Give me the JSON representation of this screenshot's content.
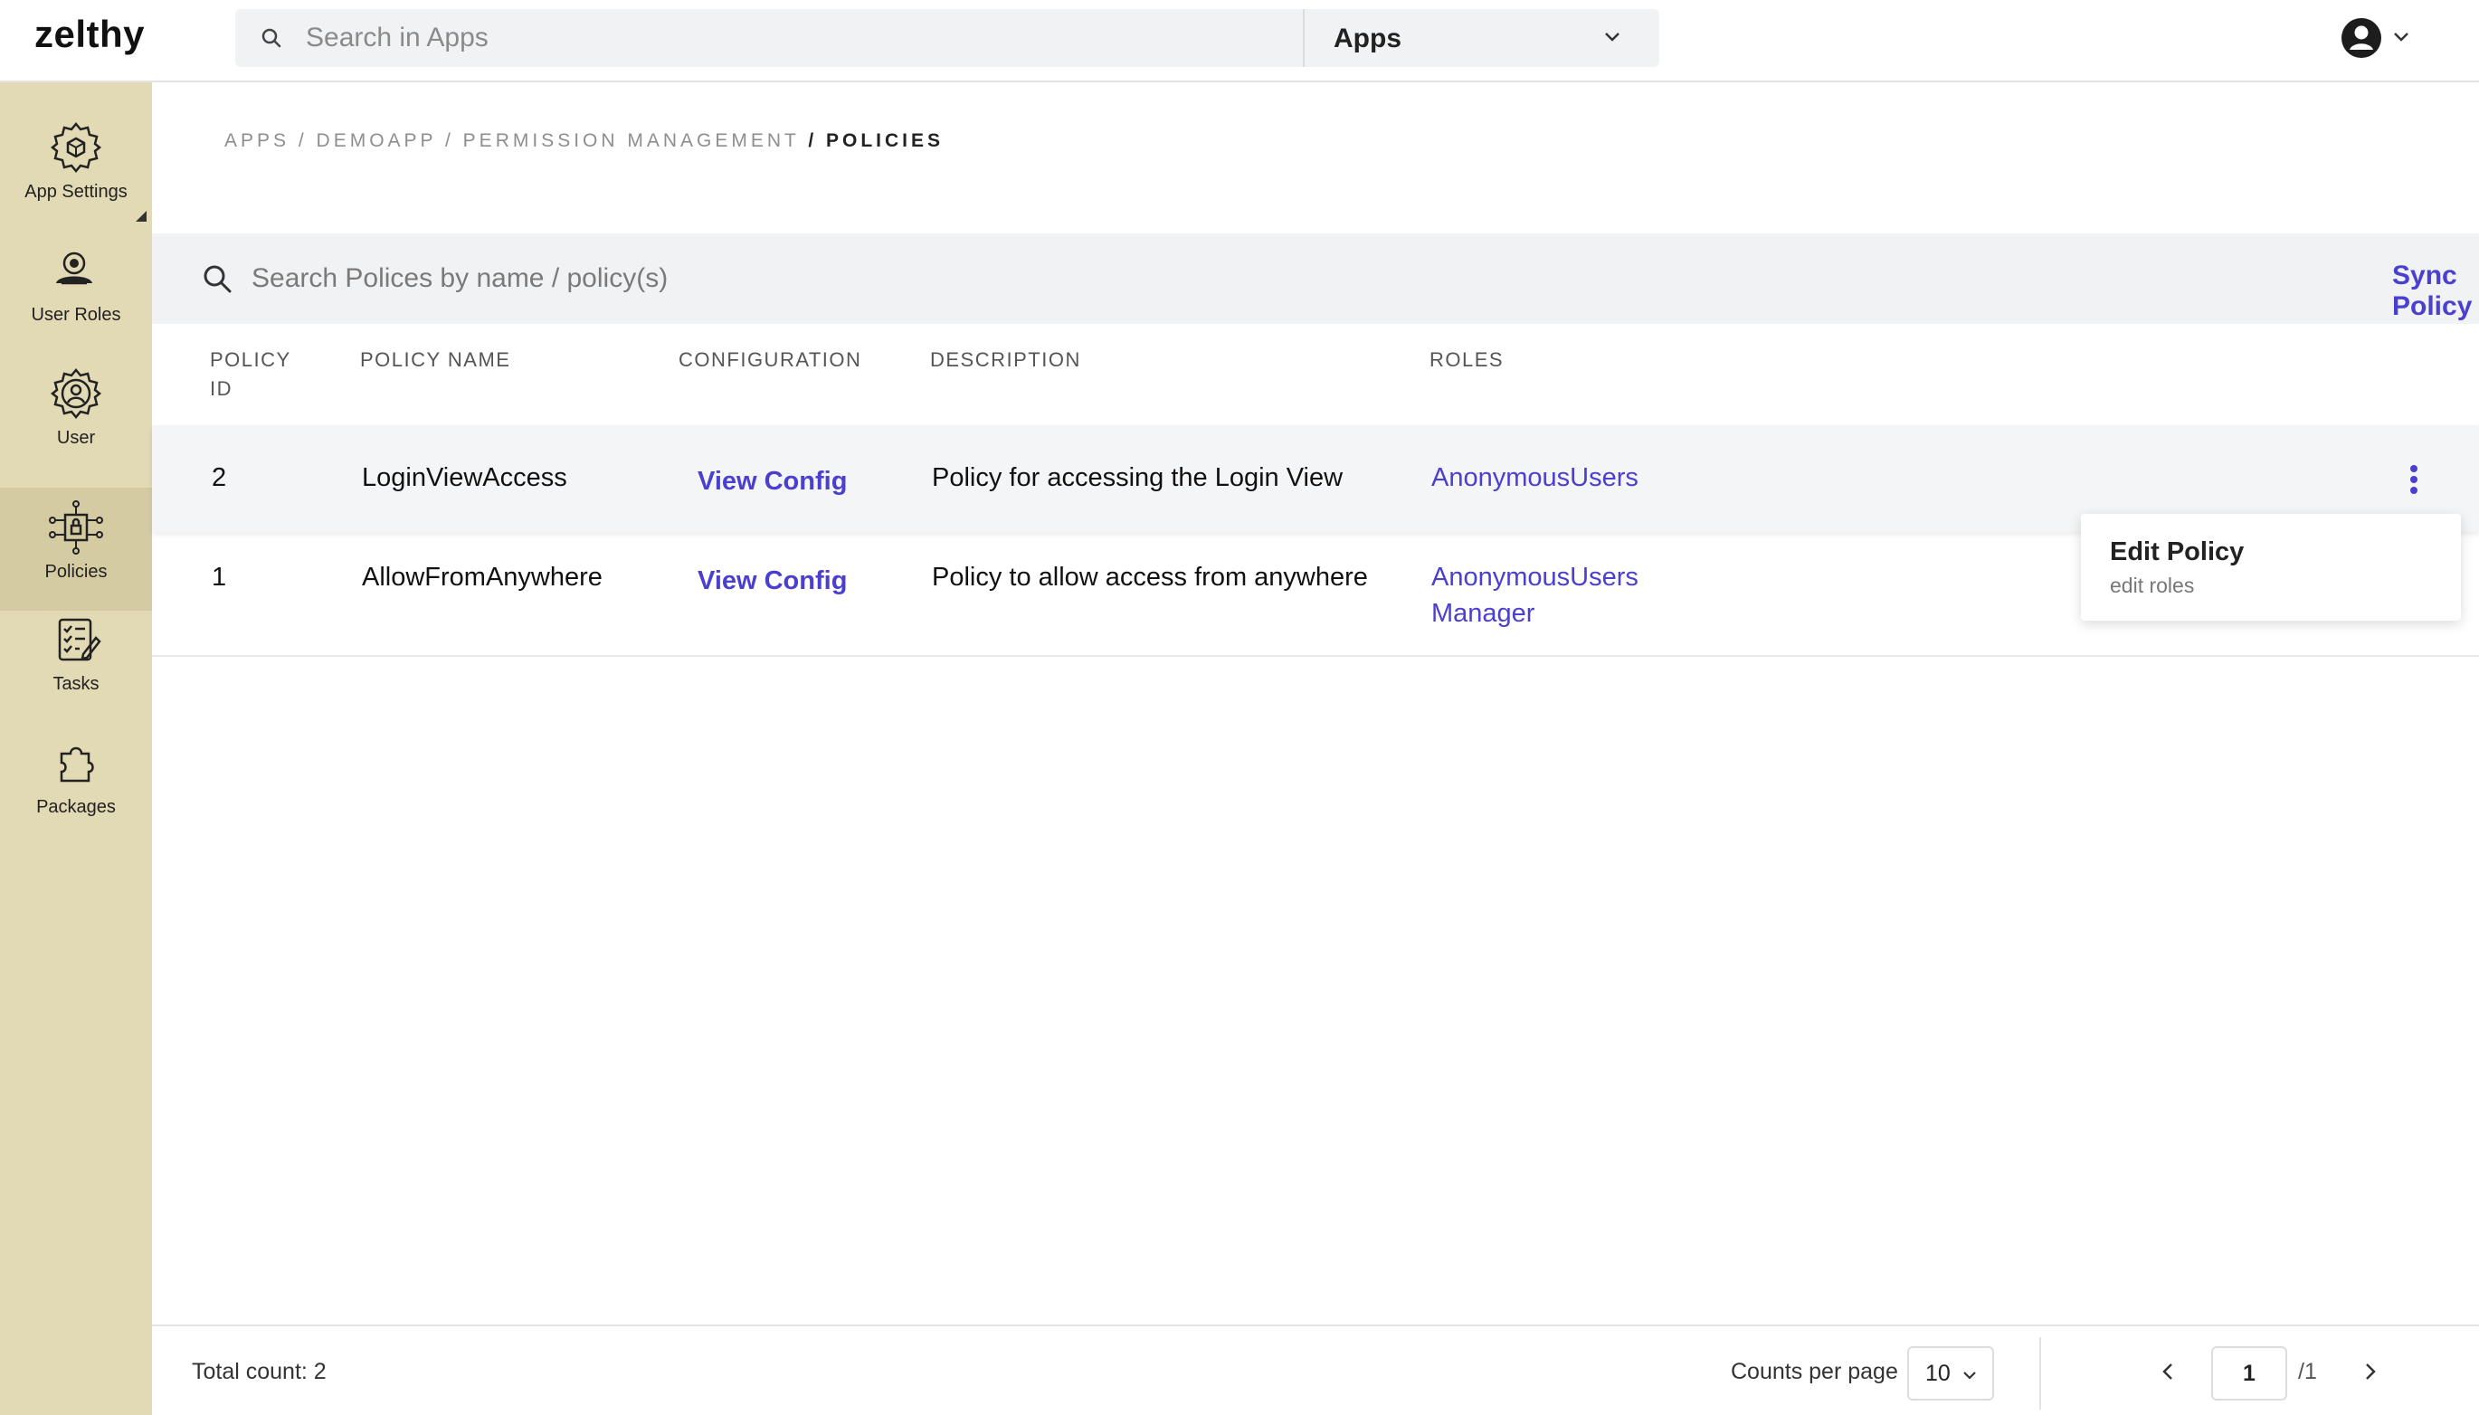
{
  "header": {
    "logo": "zelthy",
    "search_placeholder": "Search in Apps",
    "app_select_value": "Apps"
  },
  "sidebar": {
    "items": [
      {
        "label": "App Settings",
        "icon": "gear-icon"
      },
      {
        "label": "User Roles",
        "icon": "user-role-icon"
      },
      {
        "label": "User",
        "icon": "user-gear-icon"
      },
      {
        "label": "Policies",
        "icon": "policy-icon"
      },
      {
        "label": "Tasks",
        "icon": "tasks-icon"
      },
      {
        "label": "Packages",
        "icon": "package-icon"
      }
    ],
    "active": "Policies"
  },
  "breadcrumb": {
    "trail": "APPS / DEMOAPP / PERMISSION MANAGEMENT",
    "current": "/ POLICIES"
  },
  "policy_search": {
    "placeholder": "Search Polices by name / policy(s)",
    "sync_label": "Sync Policy"
  },
  "table": {
    "columns": {
      "id": "POLICY\nID",
      "name": "POLICY NAME",
      "config": "CONFIGURATION",
      "description": "DESCRIPTION",
      "roles": "ROLES"
    },
    "rows": [
      {
        "id": "2",
        "name": "LoginViewAccess",
        "config": "View Config",
        "description": "Policy for accessing the Login View",
        "roles": [
          "AnonymousUsers"
        ]
      },
      {
        "id": "1",
        "name": "AllowFromAnywhere",
        "config": "View Config",
        "description": "Policy to allow access from anywhere",
        "roles": [
          "AnonymousUsers",
          "Manager"
        ]
      }
    ]
  },
  "row_menu": {
    "title": "Edit Policy",
    "subtitle": "edit roles"
  },
  "footer": {
    "total": "Total count: 2",
    "counts_label": "Counts per page",
    "counts_value": "10",
    "page": "1",
    "page_total": "/1"
  },
  "colors": {
    "accent": "#4b3fd0",
    "sidebar_bg": "#e2d9b5",
    "sidebar_active": "#d4cba3"
  }
}
